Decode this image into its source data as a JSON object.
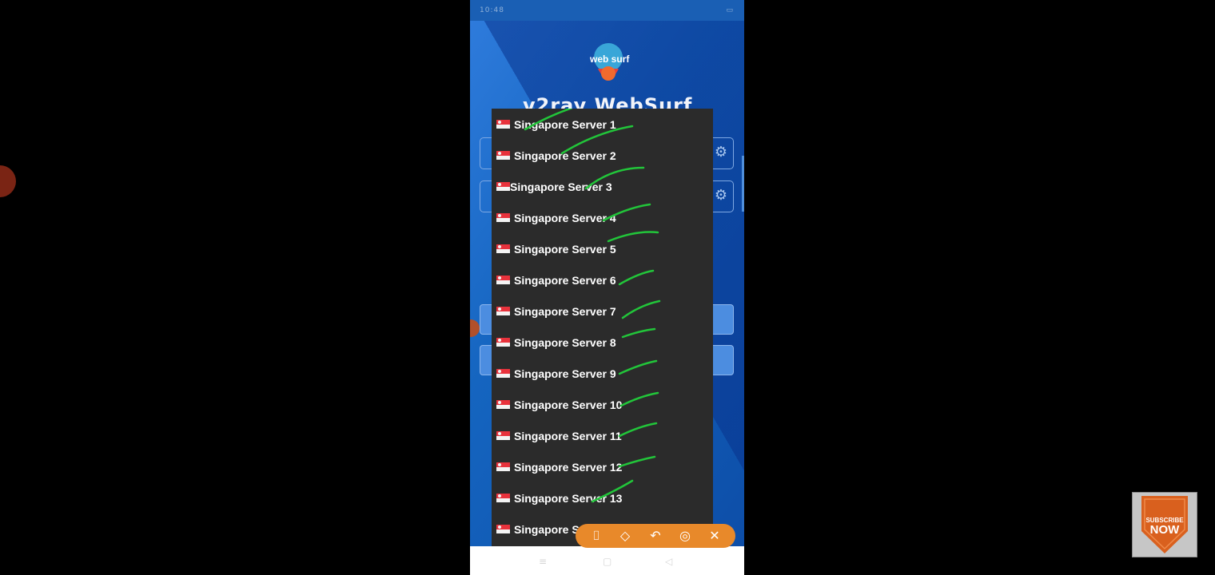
{
  "status_bar": {
    "left": "10:48",
    "right": ""
  },
  "app": {
    "title": "v2ray WebSurf",
    "logo_text": "web surf"
  },
  "server_dropdown": {
    "items": [
      "Singapore Server 1",
      "Singapore Server 2",
      "Singapore Server 3",
      "Singapore Server 4",
      "Singapore Server 5",
      "Singapore Server 6",
      "Singapore Server 7",
      "Singapore Server 8",
      "Singapore Server 9",
      "Singapore Server 10",
      "Singapore Server 11",
      "Singapore Server 12",
      "Singapore Server 13",
      "Singapore Server 14"
    ]
  },
  "annotation_toolbar": {
    "icons": [
      "camera-icon",
      "eraser-icon",
      "undo-icon",
      "palette-icon",
      "close-icon"
    ]
  },
  "subscribe_badge": {
    "line1": "SUBSCRIBE",
    "line2": "NOW"
  },
  "colors": {
    "app_blue": "#1565c0",
    "dropdown_bg": "#2b2b2b",
    "check_green": "#22c53a",
    "toolbar_orange": "#e8892a"
  }
}
